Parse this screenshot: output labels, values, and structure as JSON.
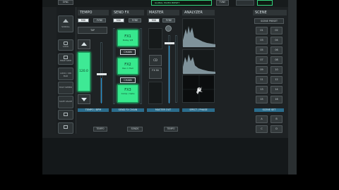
{
  "topbar": {
    "sync_label": "SYNC",
    "global_fx_label": "GLOBAL FX",
    "global_fx_sub": "GLOBAL FADER PRESET",
    "tune_label": "TUNE"
  },
  "left": {
    "scroll_label": "SCROLL",
    "buttons": [
      "LOCK",
      "SNAP GRID",
      "LOCK / ON BAR",
      "FAST SPEED",
      "SAVE VALUE"
    ]
  },
  "tempo": {
    "header": "TEMPO",
    "mix": "MIX",
    "fyre": "FYRE",
    "tap": "TAP",
    "bpm_value": "120.0",
    "footer": "TEMPO / BPM",
    "bottom_btn": "TEMPO"
  },
  "sendfx": {
    "header": "SEND FX",
    "mix": "MIX",
    "fyre": "FYRE",
    "fx": [
      {
        "label": "FX1",
        "sub": "Delay 1/8"
      },
      {
        "label": "FX2",
        "sub": "Rev 1 Hall"
      },
      {
        "label": "FX3",
        "sub": "Comp / Gate"
      }
    ],
    "chain": "CHAIN",
    "footer": "SEND FX CHAIN",
    "bottom_btn": "SENDS"
  },
  "master": {
    "header": "MASTER",
    "mix": "MIX",
    "fyre": "FYRE",
    "cd": "CD",
    "fx_in": "FX IN",
    "footer": "MASTER OUT",
    "bottom_btn": "TEMPO"
  },
  "analyzer": {
    "header": "ANALYZER",
    "footer": "SPECT / PHASE"
  },
  "scene": {
    "header": "SCENE",
    "sub": "SCENE PRESET",
    "keys": [
      "01",
      "02",
      "03",
      "04",
      "05",
      "06",
      "07",
      "08",
      "09",
      "10",
      "11",
      "12",
      "13",
      "14",
      "15",
      "16"
    ],
    "footer": "SCENE SET",
    "ab": [
      "A",
      "B"
    ],
    "cd": [
      "C",
      "D"
    ]
  },
  "colors": {
    "accent_green": "#37e88d",
    "accent_blue": "#1e8fd1",
    "panel_bg": "#1e2224"
  }
}
